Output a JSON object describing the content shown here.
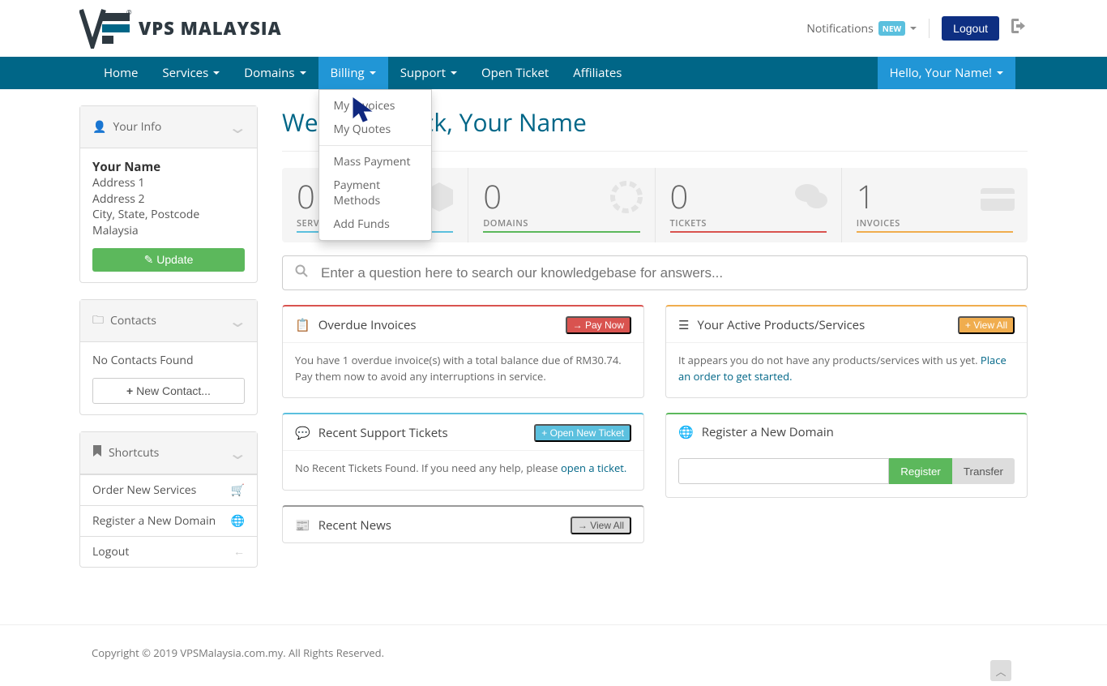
{
  "brand": "VPS MALAYSIA",
  "header": {
    "notifications": "Notifications",
    "badge_new": "NEW",
    "logout": "Logout"
  },
  "nav": {
    "home": "Home",
    "services": "Services",
    "domains": "Domains",
    "billing": "Billing",
    "support": "Support",
    "open_ticket": "Open Ticket",
    "affiliates": "Affiliates",
    "greeting": "Hello, Your Name!"
  },
  "billing_menu": {
    "my_invoices": "My Invoices",
    "my_quotes": "My Quotes",
    "mass_payment": "Mass Payment",
    "payment_methods": "Payment Methods",
    "add_funds": "Add Funds"
  },
  "sidebar": {
    "your_info": {
      "title": "Your Info",
      "name": "Your Name",
      "addr1": "Address 1",
      "addr2": "Address 2",
      "city": "City, State, Postcode",
      "country": "Malaysia",
      "update": "Update"
    },
    "contacts": {
      "title": "Contacts",
      "empty": "No Contacts Found",
      "new": "New Contact..."
    },
    "shortcuts": {
      "title": "Shortcuts",
      "items": [
        {
          "label": "Order New Services"
        },
        {
          "label": "Register a New Domain"
        },
        {
          "label": "Logout"
        }
      ]
    }
  },
  "page": {
    "title": "Welcome Back, Your Name",
    "stats": [
      {
        "num": "0",
        "label": "SERVICES",
        "color": "#5bc0de"
      },
      {
        "num": "0",
        "label": "DOMAINS",
        "color": "#5cb85c"
      },
      {
        "num": "0",
        "label": "TICKETS",
        "color": "#d9534f"
      },
      {
        "num": "1",
        "label": "INVOICES",
        "color": "#f0ad4e"
      }
    ],
    "search_placeholder": "Enter a question here to search our knowledgebase for answers..."
  },
  "cards": {
    "overdue": {
      "title": "Overdue Invoices",
      "btn": "Pay Now",
      "text": "You have 1 overdue invoice(s) with a total balance due of RM30.74. Pay them now to avoid any interruptions in service."
    },
    "products": {
      "title": "Your Active Products/Services",
      "btn": "View All",
      "text": "It appears you do not have any products/services with us yet. ",
      "link": "Place an order to get started."
    },
    "tickets": {
      "title": "Recent Support Tickets",
      "btn": "Open New Ticket",
      "text": "No Recent Tickets Found. If you need any help, please ",
      "link": "open a ticket."
    },
    "register": {
      "title": "Register a New Domain",
      "register": "Register",
      "transfer": "Transfer"
    },
    "news": {
      "title": "Recent News",
      "btn": "View All"
    }
  },
  "footer": "Copyright © 2019 VPSMalaysia.com.my. All Rights Reserved."
}
